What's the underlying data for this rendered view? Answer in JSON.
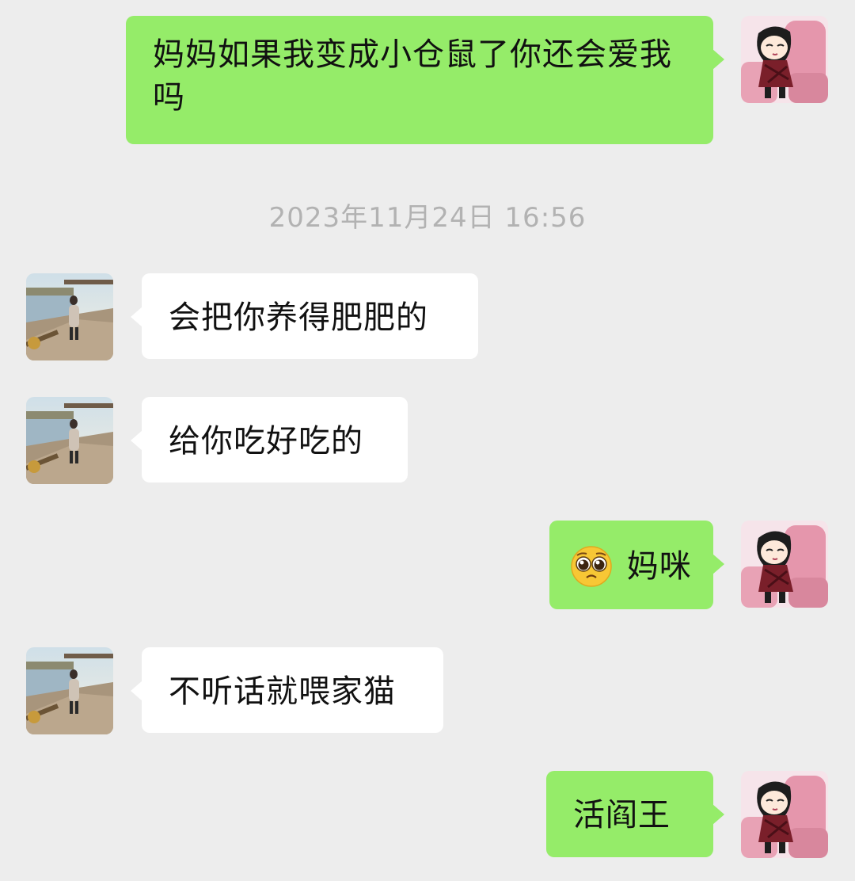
{
  "conversation": {
    "timestamp": "2023年11月24日 16:56",
    "messages": [
      {
        "sender": "me",
        "text": "妈妈如果我变成小仓鼠了你还会爱我吗"
      },
      {
        "sender": "mom",
        "text": "会把你养得肥肥的"
      },
      {
        "sender": "mom",
        "text": "给你吃好吃的"
      },
      {
        "sender": "me",
        "emoji": "pleading-face",
        "text": "妈咪"
      },
      {
        "sender": "mom",
        "text": "不听话就喂家猫"
      },
      {
        "sender": "me",
        "text": "活阎王"
      }
    ]
  },
  "colors": {
    "background": "#ededed",
    "outgoing_bubble": "#95ec69",
    "incoming_bubble": "#ffffff",
    "timestamp_text": "#b2b2b2"
  },
  "icons": {
    "my_avatar": "cartoon-girl-avatar",
    "mom_avatar": "lakeside-photo-avatar",
    "emoji": "pleading-face-emoji"
  }
}
